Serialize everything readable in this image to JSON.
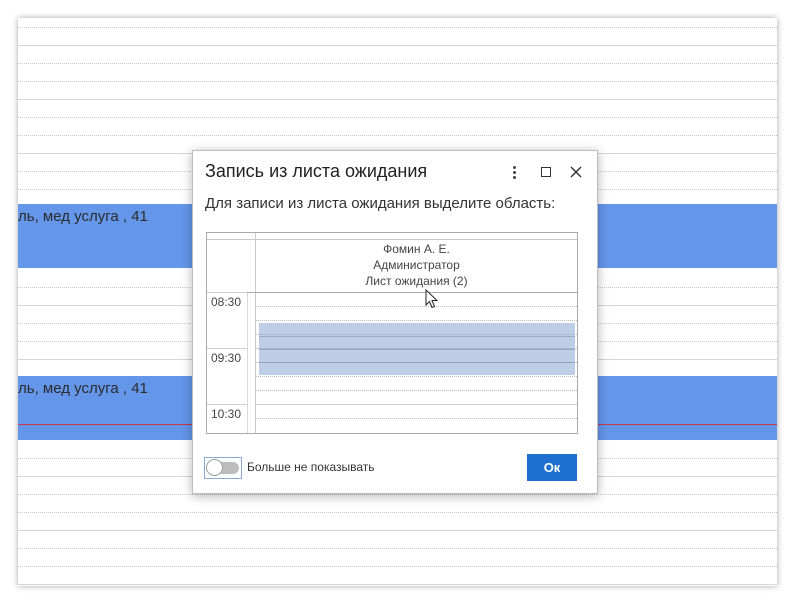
{
  "background": {
    "appointments": [
      {
        "text": "ль, мед услуга , 41"
      },
      {
        "text": "ль, мед услуга , 41"
      }
    ]
  },
  "dialog": {
    "title": "Запись из листа ожидания",
    "message": "Для записи из листа ожидания выделите область:",
    "menu_icon": "more-vertical-icon",
    "maximize_icon": "maximize-icon",
    "close_icon": "close-icon",
    "scheduler": {
      "resource": {
        "name": "Фомин А. Е.",
        "role": "Администратор",
        "waitlist": "Лист ожидания (2)"
      },
      "times": [
        "08:30",
        "09:30",
        "10:30"
      ]
    },
    "toggle_label": "Больше не показывать",
    "toggle_on": false,
    "ok_label": "Ок"
  },
  "colors": {
    "appointment": "#6496ea",
    "selection": "#7c9ece",
    "primary_button": "#1f6fd1",
    "now_line": "#c8384a"
  }
}
